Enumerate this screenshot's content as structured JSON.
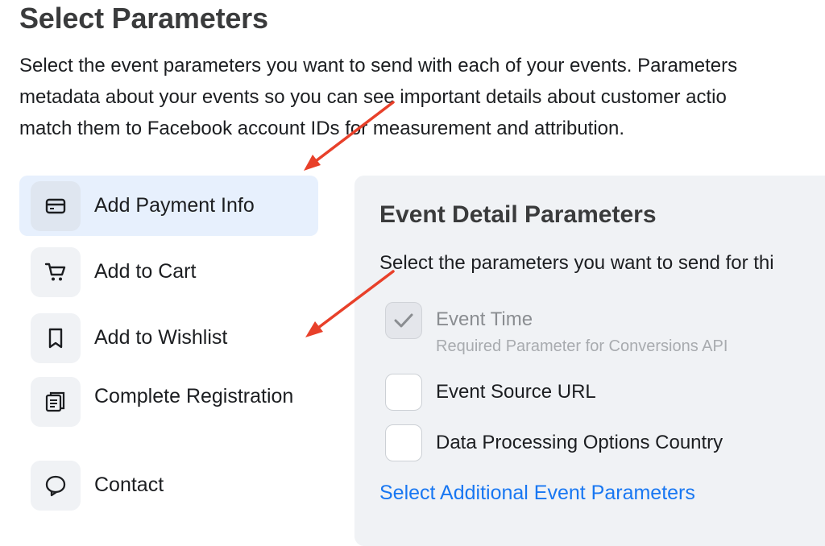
{
  "header": {
    "title": "Select Parameters",
    "description_lines": [
      "Select the event parameters you want to send with each of your events. Parameters",
      "metadata about your events so you can see important details about customer actio",
      "match them to Facebook account IDs for measurement and attribution."
    ]
  },
  "events": [
    {
      "label": "Add Payment Info",
      "icon": "credit-card-icon",
      "selected": true
    },
    {
      "label": "Add to Cart",
      "icon": "cart-icon",
      "selected": false
    },
    {
      "label": "Add to Wishlist",
      "icon": "bookmark-icon",
      "selected": false
    },
    {
      "label": "Complete Registration",
      "icon": "registration-form-icon",
      "selected": false
    },
    {
      "label": "Contact",
      "icon": "chat-bubble-icon",
      "selected": false
    }
  ],
  "panel": {
    "title": "Event Detail Parameters",
    "description": "Select the parameters you want to send for thi",
    "parameters": [
      {
        "label": "Event Time",
        "sublabel": "Required Parameter for Conversions API",
        "checked": true,
        "disabled": true
      },
      {
        "label": "Event Source URL",
        "checked": false,
        "disabled": false
      },
      {
        "label": "Data Processing Options Country",
        "checked": false,
        "disabled": false
      }
    ],
    "link": "Select Additional Event Parameters"
  },
  "colors": {
    "accent": "#1877f2",
    "selected_bg": "#e7f0fd",
    "panel_bg": "#f0f2f5",
    "annotation_arrow": "#e8402a"
  }
}
